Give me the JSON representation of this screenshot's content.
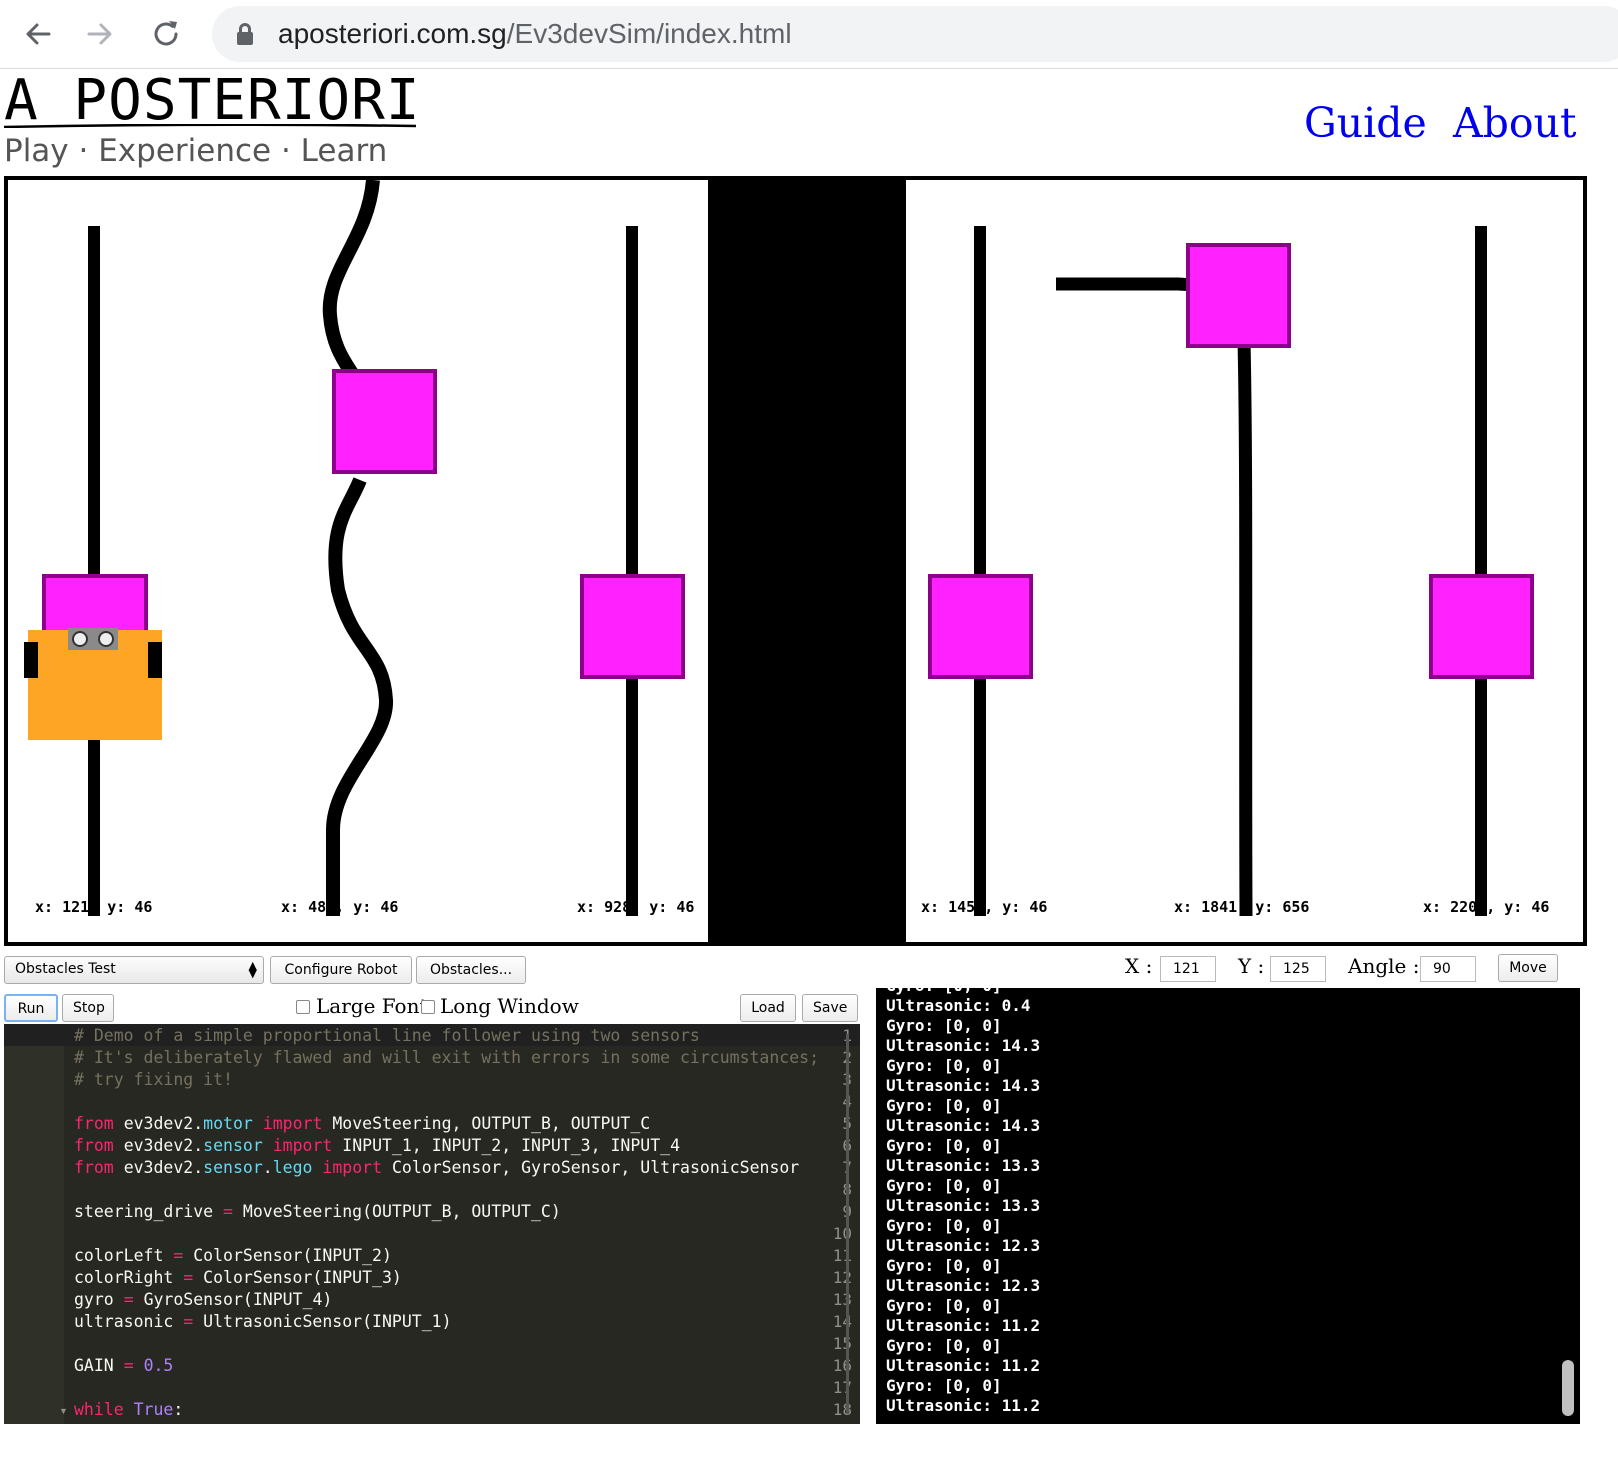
{
  "browser": {
    "url_domain": "aposteriori.com.sg",
    "url_path": "/Ev3devSim/index.html"
  },
  "site": {
    "logo": "A POSTERIORI",
    "tagline": "Play · Experience · Learn",
    "nav": [
      "Guide",
      "About"
    ]
  },
  "sim": {
    "coords": [
      "x: 121, y: 46",
      "x: 488, y: 46",
      "x: 928, y: 46",
      "x: 1450, y: 46",
      "x: 1841, y: 656",
      "x: 2202, y: 46"
    ],
    "colors": {
      "obstacle": "#ff22ff",
      "obstacle_border": "#8c008c",
      "robot": "#ffa526",
      "line": "#000000"
    }
  },
  "controls": {
    "world_select": "Obstacles Test",
    "configure_robot": "Configure Robot",
    "obstacles": "Obstacles...",
    "x_label": "X :",
    "x_value": "121",
    "y_label": "Y :",
    "y_value": "125",
    "angle_label": "Angle :",
    "angle_value": "90",
    "move": "Move",
    "run": "Run",
    "stop": "Stop",
    "large_font": "Large Font",
    "long_window": "Long Window",
    "load": "Load",
    "save": "Save"
  },
  "editor": {
    "line_numbers": [
      "1",
      "2",
      "3",
      "4",
      "5",
      "6",
      "7",
      "8",
      "9",
      "10",
      "11",
      "12",
      "13",
      "14",
      "15",
      "16",
      "17",
      "18"
    ],
    "comments": [
      "# Demo of a simple proportional line follower using two sensors",
      "# It's deliberately flawed and will exit with errors in some circumstances;",
      "# try fixing it!"
    ],
    "kw_from": "from",
    "kw_import": "import",
    "mod_ev3dev2": "ev3dev2",
    "mod_motor": "motor",
    "mod_sensor": "sensor",
    "mod_lego": "lego",
    "imp5": "MoveSteering, OUTPUT_B, OUTPUT_C",
    "imp6": "INPUT_1, INPUT_2, INPUT_3, INPUT_4",
    "imp7": "ColorSensor, GyroSensor, UltrasonicSensor",
    "l9_var": "steering_drive",
    "l9_val": "MoveSteering(OUTPUT_B, OUTPUT_C)",
    "l11_var": "colorLeft",
    "l11_val": "ColorSensor(INPUT_2)",
    "l12_var": "colorRight",
    "l12_val": "ColorSensor(INPUT_3)",
    "l13_var": "gyro",
    "l13_val": "GyroSensor(INPUT_4)",
    "l14_var": "ultrasonic",
    "l14_val": "UltrasonicSensor(INPUT_1)",
    "l16_var": "GAIN",
    "l16_val": "0.5",
    "eq": "=",
    "l18_kw": "while",
    "l18_const": "True",
    "l18_colon": ":"
  },
  "console": {
    "lines": [
      "Ultrasonic: 0.4",
      "Gyro: [0, 0]",
      "Ultrasonic: 14.3",
      "Gyro: [0, 0]",
      "Ultrasonic: 14.3",
      "Gyro: [0, 0]",
      "Ultrasonic: 14.3",
      "Gyro: [0, 0]",
      "Ultrasonic: 13.3",
      "Gyro: [0, 0]",
      "Ultrasonic: 13.3",
      "Gyro: [0, 0]",
      "Ultrasonic: 12.3",
      "Gyro: [0, 0]",
      "Ultrasonic: 12.3",
      "Gyro: [0, 0]",
      "Ultrasonic: 11.2",
      "Gyro: [0, 0]",
      "Ultrasonic: 11.2",
      "Gyro: [0, 0]",
      "Ultrasonic: 11.2"
    ]
  }
}
